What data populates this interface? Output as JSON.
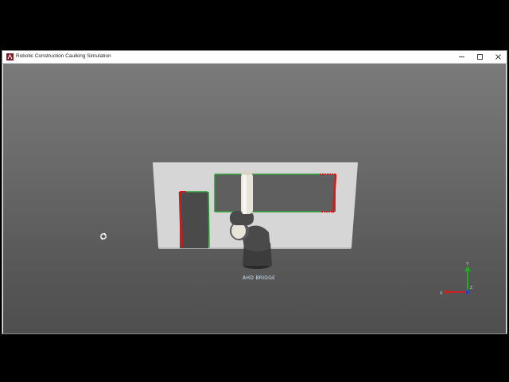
{
  "window": {
    "title": "Robotic Construction Caulking Simulation",
    "controls": {
      "minimize": "minimize-icon",
      "maximize": "maximize-icon",
      "close": "close-icon"
    }
  },
  "viewport": {
    "robot_brand_label": "AHD BRIDGE",
    "axes": {
      "x": "X",
      "y": "Y",
      "z": "Z"
    },
    "colors": {
      "completed_seam": "#2e9e3a",
      "pending_seam": "#d11a1a",
      "wall": "#d6d6d6",
      "robot_arm": "#e8e4da",
      "robot_base": "#3c3c3c"
    }
  }
}
